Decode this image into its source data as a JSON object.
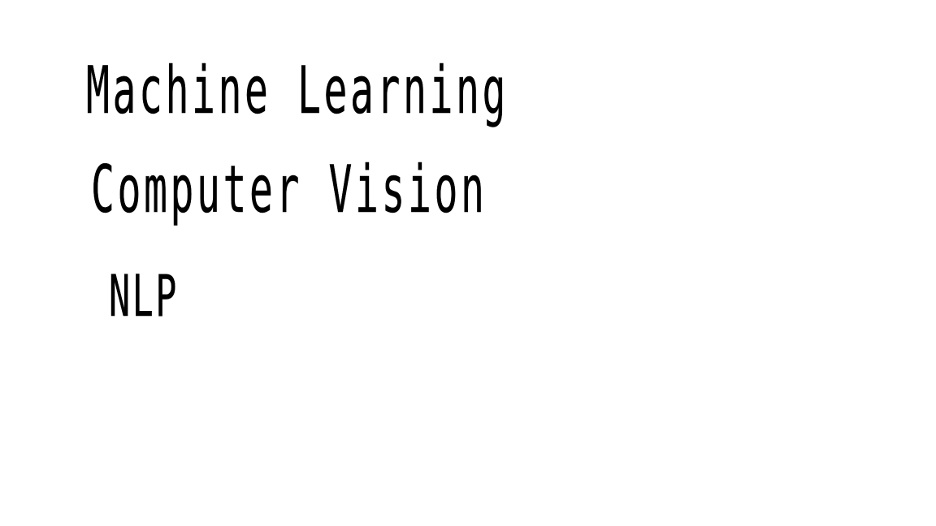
{
  "canvas": {
    "background": "#ffffff",
    "ink_color": "#000000",
    "lines": [
      {
        "text": "Machine Learning"
      },
      {
        "text": "Computer Vision"
      },
      {
        "text": "NLP"
      }
    ]
  }
}
